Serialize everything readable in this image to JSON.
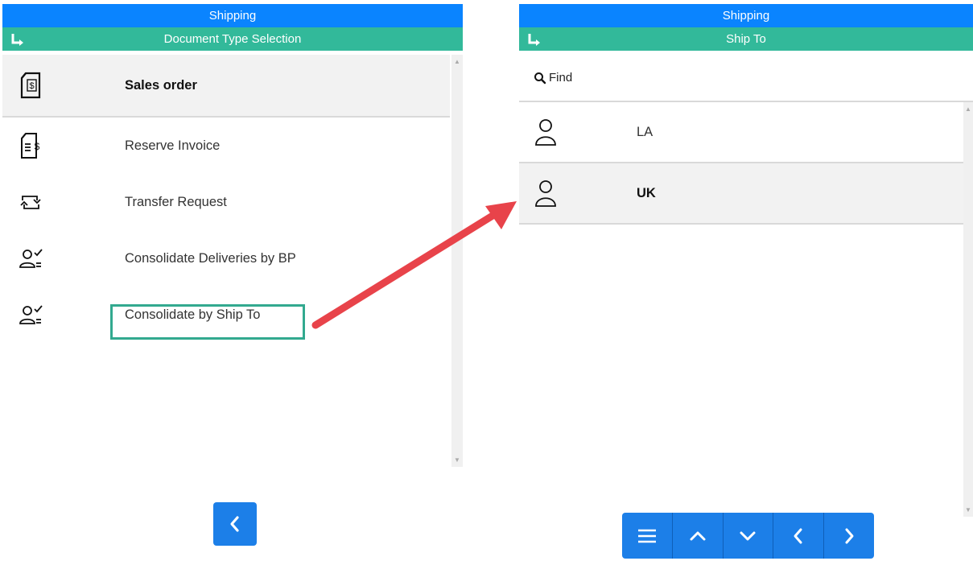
{
  "left_screen": {
    "title": "Shipping",
    "subtitle": "Document Type Selection",
    "items": [
      {
        "label": "Sales order",
        "icon": "document-dollar-icon",
        "selected": true
      },
      {
        "label": "Reserve Invoice",
        "icon": "invoice-dollar-icon"
      },
      {
        "label": "Transfer Request",
        "icon": "transfer-icon"
      },
      {
        "label": "Consolidate Deliveries by BP",
        "icon": "user-check-icon"
      },
      {
        "label": "Consolidate by Ship To",
        "icon": "user-check-icon",
        "highlighted": true
      }
    ],
    "back_button_icon": "chevron-left-icon"
  },
  "right_screen": {
    "title": "Shipping",
    "subtitle": "Ship To",
    "find": {
      "label": "Find",
      "icon": "search-icon"
    },
    "items": [
      {
        "label": "LA",
        "icon": "user-icon"
      },
      {
        "label": "UK",
        "icon": "user-icon",
        "selected": true
      }
    ],
    "toolbar": [
      {
        "icon": "menu-icon"
      },
      {
        "icon": "chevron-up-icon"
      },
      {
        "icon": "chevron-down-icon"
      },
      {
        "icon": "chevron-left-icon"
      },
      {
        "icon": "chevron-right-icon"
      }
    ]
  },
  "colors": {
    "title_bar": "#0a84ff",
    "sub_bar": "#32b99a",
    "button": "#1c7fe8",
    "selected_row": "#f2f2f2",
    "annotation_arrow": "#e8434a",
    "highlight_box": "#32a98f"
  }
}
